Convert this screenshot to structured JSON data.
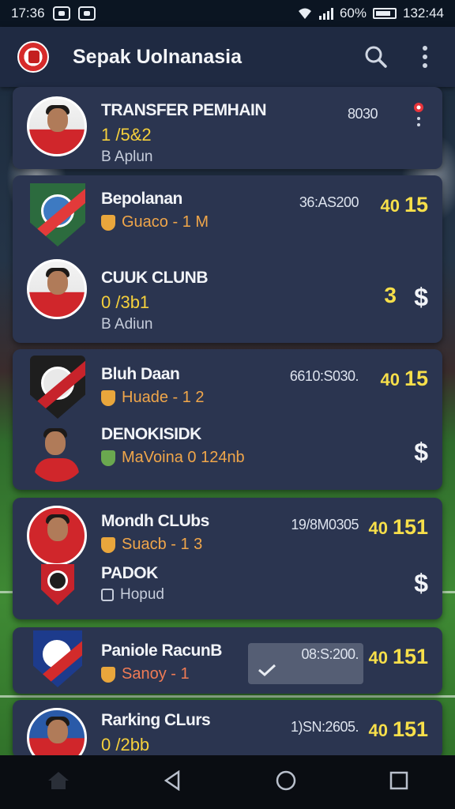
{
  "status_bar": {
    "time_left": "17:36",
    "battery_pct": "60%",
    "time_right": "132:44"
  },
  "app_bar": {
    "title": "Sepak Uolnanasia"
  },
  "cards": [
    {
      "rows": [
        {
          "name": "TRANSFER PEMHAIN",
          "line2": "1 /5&2",
          "line3": "B   Aplun",
          "code": "8030"
        }
      ]
    },
    {
      "rows": [
        {
          "name": "Bepolanan",
          "line2": "Guaco  - 1 M",
          "code": "36:AS200",
          "score_small": "40",
          "score": "15"
        },
        {
          "name": "CUUK CLUNB",
          "line2": "0 /3b1",
          "line3": "B   Adiun",
          "score_big": "3",
          "dollar": "$"
        }
      ]
    },
    {
      "rows": [
        {
          "name": "Bluh Daan",
          "line2": "Huade  - 1 2",
          "code": "6610:S030.",
          "score_small": "40",
          "score": "15"
        },
        {
          "name": "DENOKISIDK",
          "line2": "MaVoina  0  124nb",
          "dollar": "$"
        }
      ]
    },
    {
      "rows": [
        {
          "name": "Mondh CLUbs",
          "line2": "Suacb  - 1 3",
          "code": "19/8M0305",
          "score_small": "40",
          "score": "151"
        },
        {
          "name": "PADOK",
          "line3": "Hopud",
          "dollar": "$"
        }
      ]
    },
    {
      "rows": [
        {
          "name": "Paniole RacunB",
          "line2": "Sanoy   -  1",
          "code": "08:S:200.",
          "score_small": "40",
          "score": "151"
        }
      ]
    },
    {
      "rows": [
        {
          "name": "Rarking CLurs",
          "line2": "0 /2bb",
          "code": "1)SN:2605.",
          "score_small": "40",
          "score": "151"
        }
      ]
    }
  ]
}
